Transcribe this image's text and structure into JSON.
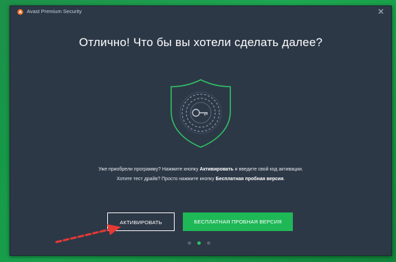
{
  "window": {
    "title": "Avast Premium Security",
    "close_label": "✕"
  },
  "main": {
    "headline": "Отлично! Что бы вы хотели сделать далее?",
    "info_line1": {
      "pre": "Уже приобрели программу? Нажмите кнопку ",
      "bold": "Активировать",
      "post": " и введите свой код активации."
    },
    "info_line2": {
      "pre": "Хотите тест драйв? Просто нажмите кнопку ",
      "bold": "Бесплатная пробная версия",
      "post": "."
    }
  },
  "buttons": {
    "activate_label": "АКТИВИРОВАТЬ",
    "trial_label": "БЕСПЛАТНАЯ ПРОБНАЯ ВЕРСИЯ"
  },
  "pagination": {
    "count": 3,
    "active_index": 1
  },
  "colors": {
    "desktop": "#1aa64f",
    "window_bg": "#2d3847",
    "accent_green": "#1fb857",
    "logo_orange": "#f37021",
    "annotation_red": "#e53935"
  },
  "icons": {
    "app_logo": "avast-logo-icon",
    "shield": "shield-key-icon",
    "annotation": "red-dashed-arrow"
  }
}
